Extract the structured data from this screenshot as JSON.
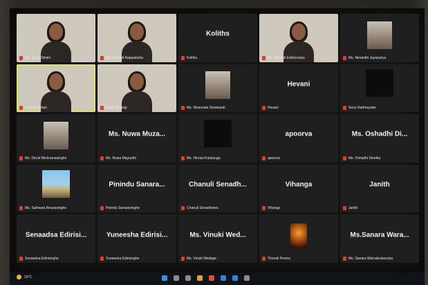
{
  "meeting": {
    "tiles": [
      {
        "kind": "video",
        "label": "Ms. Isuru Dilmini",
        "active": false
      },
      {
        "kind": "video",
        "label": "Ms. Sandali Rajapaksha",
        "active": false
      },
      {
        "kind": "name",
        "name": "Koliths",
        "label": "Kolithu",
        "active": false
      },
      {
        "kind": "video",
        "label": "Ms. Hansali Edirisooriya",
        "active": false
      },
      {
        "kind": "photo",
        "label": "Ms. Nimanthi Jayasuriya",
        "active": false
      },
      {
        "kind": "video",
        "label": "Ishara Dilshan",
        "active": true
      },
      {
        "kind": "video",
        "label": "Anjali Dilrangi",
        "active": false
      },
      {
        "kind": "photo",
        "label": "Ms. Nisansala Sewwandi",
        "active": false
      },
      {
        "kind": "name",
        "name": "Hevani",
        "label": "Hevani",
        "active": false
      },
      {
        "kind": "dark",
        "label": "Senu Rathnayake",
        "active": false
      },
      {
        "kind": "photo",
        "label": "Ms. Dinuli Wickramasinghe",
        "active": false
      },
      {
        "kind": "name",
        "name": "Ms. Nuwa Muza...",
        "label": "Ms. Nuwa Mayanthi",
        "active": false
      },
      {
        "kind": "dark",
        "label": "Ms. Himasi Kulatunga",
        "active": false
      },
      {
        "kind": "name",
        "name": "apoorva",
        "label": "apoorva",
        "active": false
      },
      {
        "kind": "name",
        "name": "Ms. Oshadhi Di...",
        "label": "Ms. Oshadhi Dinelka",
        "active": false
      },
      {
        "kind": "sea",
        "label": "Ms. Sathsara Amarasinghe",
        "active": false
      },
      {
        "kind": "name",
        "name": "Pinindu Sanara...",
        "label": "Pinindu Sanarasinghe",
        "active": false
      },
      {
        "kind": "name",
        "name": "Chanuli Senadh...",
        "label": "Chanuli Senadheera",
        "active": false
      },
      {
        "kind": "name",
        "name": "Vihanga",
        "label": "Vihanga",
        "active": false
      },
      {
        "kind": "name",
        "name": "Janith",
        "label": "Janith",
        "active": false
      },
      {
        "kind": "name",
        "name": "Senaadsa Edirisi...",
        "label": "Senaadsa Edirisinghe",
        "active": false
      },
      {
        "kind": "name",
        "name": "Yuneesha Edirisi...",
        "label": "Yuneesha Edirisinghe",
        "active": false
      },
      {
        "kind": "name",
        "name": "Ms. Vinuki Wed...",
        "label": "Ms. Vinuki Wedage",
        "active": false
      },
      {
        "kind": "torch",
        "label": "Thenuli Perera",
        "active": false
      },
      {
        "kind": "name",
        "name": "Ms.Sanara Wara...",
        "label": "Ms. Sanara Warnakulasuriya",
        "active": false
      }
    ]
  },
  "taskbar": {
    "weather_temp": "29°C",
    "weather_icon": "sun-icon",
    "icons": [
      "windows-start-icon",
      "search-icon",
      "task-view-icon",
      "file-explorer-icon",
      "browser-icon",
      "zoom-icon",
      "edge-icon",
      "settings-icon"
    ]
  },
  "colors": {
    "tile_bg": "#1f1f1f",
    "active_speaker": "#d9e26a",
    "muted_mic": "#e23b2e"
  }
}
